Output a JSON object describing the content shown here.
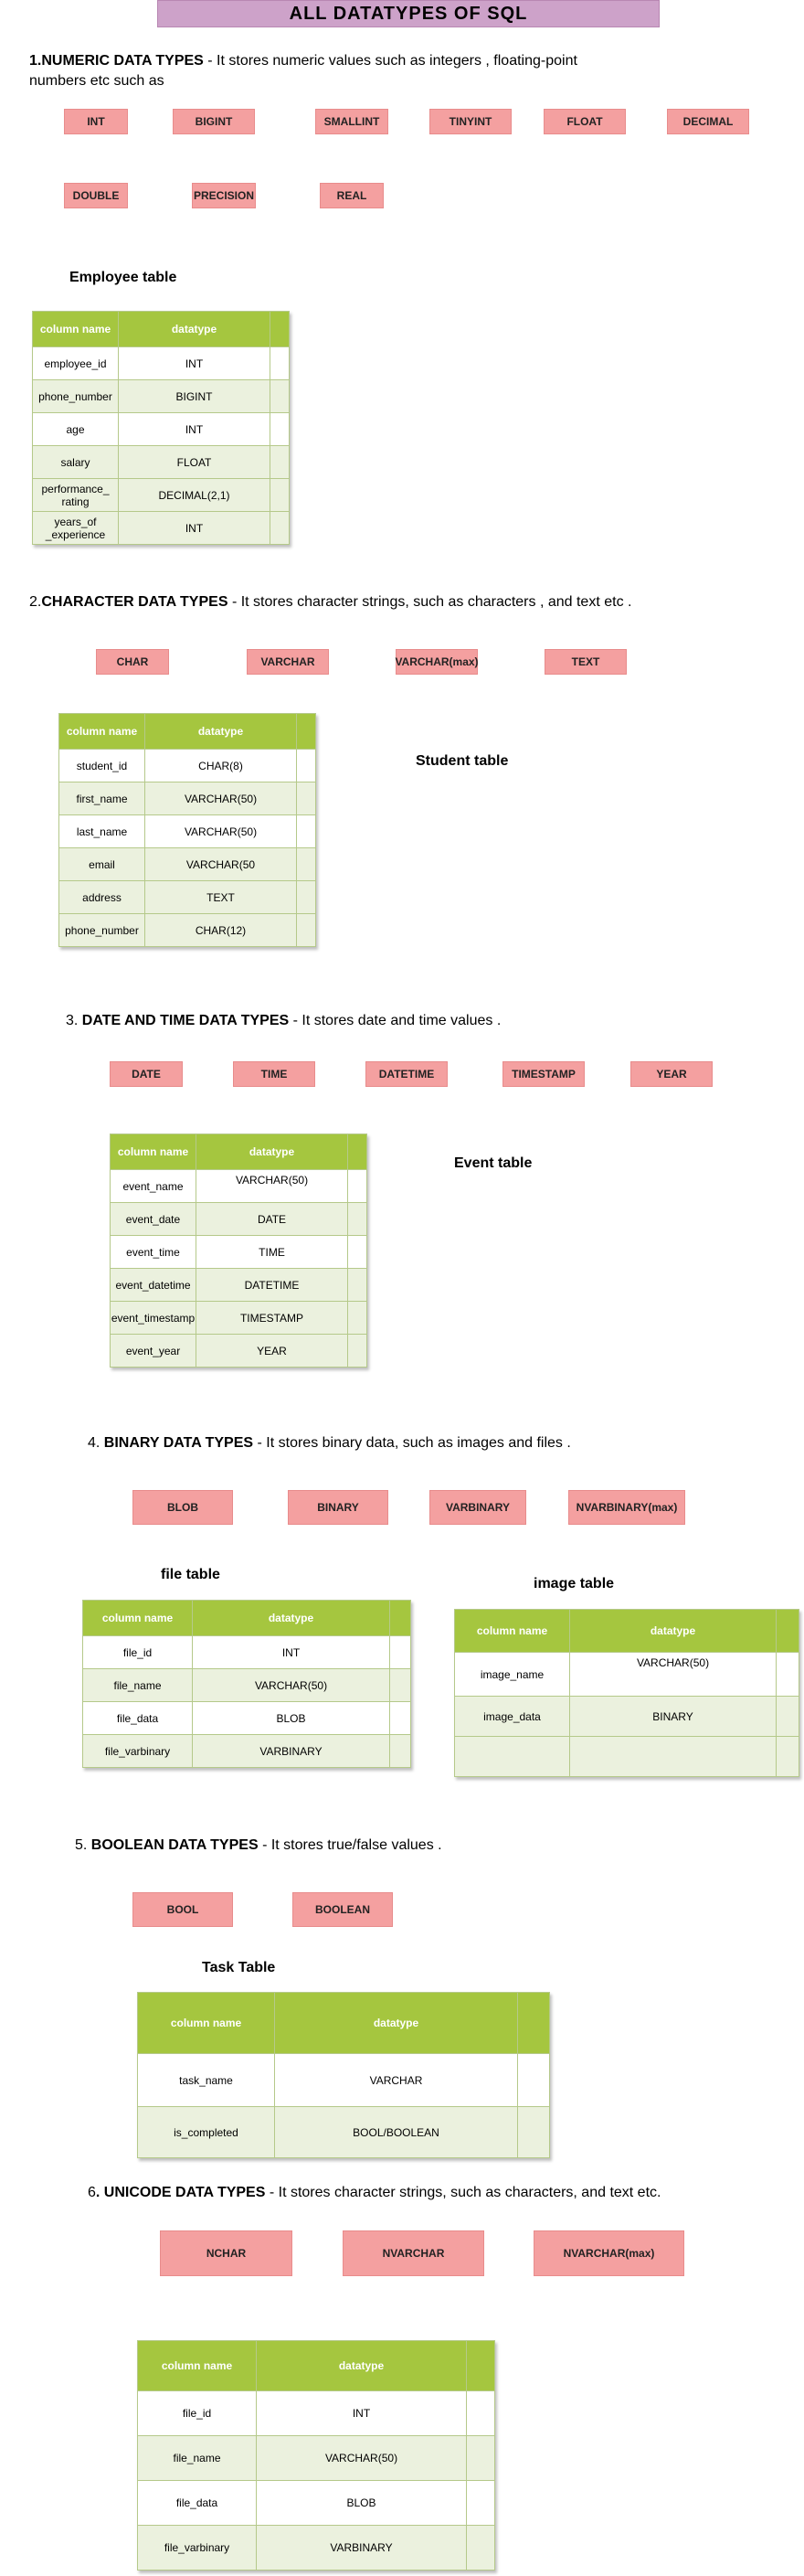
{
  "title": "ALL  DATATYPES OF SQL",
  "sections": [
    {
      "head_bold": "1.NUMERIC DATA TYPES",
      "head_rest": "  - It stores numeric values  such as integers , floating-point",
      "head_line2": "numbers etc such as",
      "tags": [
        "INT",
        "BIGINT",
        "SMALLINT",
        "TINYINT",
        "FLOAT",
        "DECIMAL",
        "DOUBLE",
        "PRECISION",
        "REAL"
      ],
      "tables": [
        {
          "title": "Employee table",
          "header": [
            "column name",
            "datatype"
          ],
          "rows": [
            [
              "employee_id",
              "INT"
            ],
            [
              "phone_number",
              "BIGINT"
            ],
            [
              "age",
              "INT"
            ],
            [
              "salary",
              "FLOAT"
            ],
            [
              "performance_\nrating",
              "DECIMAL(2,1)"
            ],
            [
              "years_of\n_experience",
              "INT"
            ]
          ]
        }
      ]
    },
    {
      "head_pre": "2.",
      "head_bold": "CHARACTER DATA TYPES",
      "head_rest": "  - It stores character strings, such as characters , and text etc .",
      "tags": [
        "CHAR",
        "VARCHAR",
        "VARCHAR(max)",
        "TEXT"
      ],
      "tables": [
        {
          "title": "Student table",
          "header": [
            "column name",
            "datatype"
          ],
          "rows": [
            [
              "student_id",
              "CHAR(8)"
            ],
            [
              "first_name",
              "VARCHAR(50)"
            ],
            [
              "last_name",
              "VARCHAR(50)"
            ],
            [
              "email",
              "VARCHAR(50"
            ],
            [
              "address",
              "TEXT"
            ],
            [
              "phone_number",
              "CHAR(12)"
            ]
          ]
        }
      ]
    },
    {
      "head_pre": "3. ",
      "head_bold": "DATE AND TIME DATA TYPES",
      "head_rest": "  - It stores date and time values .",
      "tags": [
        "DATE",
        "TIME",
        "DATETIME",
        "TIMESTAMP",
        "YEAR"
      ],
      "tables": [
        {
          "title": "Event table",
          "header": [
            "column name",
            "datatype"
          ],
          "rows": [
            [
              "event_name",
              "VARCHAR(50)"
            ],
            [
              "event_date",
              "DATE"
            ],
            [
              "event_time",
              "TIME"
            ],
            [
              "event_datetime",
              "DATETIME"
            ],
            [
              "event_timestamp",
              "TIMESTAMP"
            ],
            [
              "event_year",
              "YEAR"
            ]
          ]
        }
      ]
    },
    {
      "head_pre": "4. ",
      "head_bold": "BINARY  DATA TYPES",
      "head_rest": "  - It stores binary data, such as images and files .",
      "tags": [
        "BLOB",
        "BINARY",
        "VARBINARY",
        "NVARBINARY(max)"
      ],
      "tables": [
        {
          "title": "file table",
          "header": [
            "column name",
            "datatype"
          ],
          "rows": [
            [
              "file_id",
              "INT"
            ],
            [
              "file_name",
              "VARCHAR(50)"
            ],
            [
              "file_data",
              "BLOB"
            ],
            [
              "file_varbinary",
              "VARBINARY"
            ]
          ]
        },
        {
          "title": "image table",
          "header": [
            "column name",
            "datatype"
          ],
          "rows": [
            [
              "image_name",
              "VARCHAR(50)"
            ],
            [
              "image_data",
              "BINARY"
            ],
            [
              "",
              ""
            ]
          ]
        }
      ]
    },
    {
      "head_pre": "5. ",
      "head_bold": "BOOLEAN  DATA TYPES",
      "head_rest": "  - It stores true/false values .",
      "tags": [
        "BOOL",
        "BOOLEAN"
      ],
      "tables": [
        {
          "title": "Task Table",
          "header": [
            "column name",
            "datatype"
          ],
          "rows": [
            [
              "task_name",
              "VARCHAR"
            ],
            [
              "is_completed",
              "BOOL/BOOLEAN"
            ]
          ]
        }
      ]
    },
    {
      "head_pre": "6",
      "head_bold": ". UNICODE DATA TYPES",
      "head_rest": "  - It stores character strings, such as characters, and text etc.",
      "tags": [
        "NCHAR",
        "NVARCHAR",
        "NVARCHAR(max)"
      ],
      "tables": [
        {
          "header": [
            "column name",
            "datatype"
          ],
          "rows": [
            [
              "file_id",
              "INT"
            ],
            [
              "file_name",
              "VARCHAR(50)"
            ],
            [
              "file_data",
              "BLOB"
            ],
            [
              "file_varbinary",
              "VARBINARY"
            ]
          ]
        }
      ]
    }
  ],
  "colors": {
    "title_bg": "#cda2c9",
    "tag_bg": "#f4a0a0",
    "table_header_bg": "#a5c63f",
    "table_alt_row_bg": "#ebf1de"
  }
}
